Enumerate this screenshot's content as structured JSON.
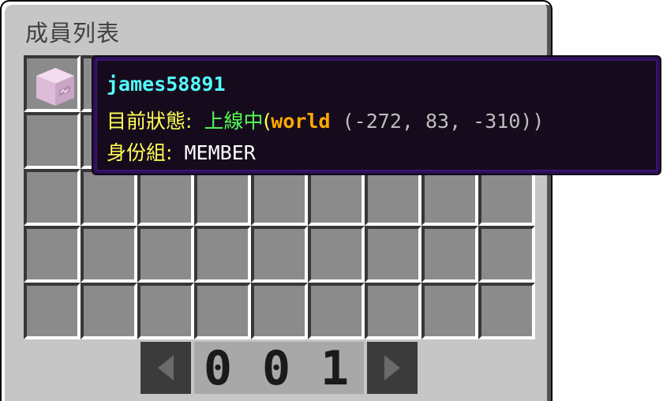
{
  "window": {
    "title": "成員列表"
  },
  "grid": {
    "rows": 5,
    "cols": 9,
    "filled_slot": "member-head-block"
  },
  "tooltip": {
    "player_name": "james58891",
    "status_label": "目前狀態:",
    "status_value": "上線中",
    "open_paren": "(",
    "world": "world",
    "coords": "(-272, 83, -310))",
    "role_label": "身份組:",
    "role_value": "MEMBER"
  },
  "pagination": {
    "digit1": "0",
    "digit2": "0",
    "digit3": "1",
    "prev_icon": "triangle-left-icon",
    "next_icon": "triangle-right-icon"
  },
  "colors": {
    "panel": "#c6c6c6",
    "slot": "#8b8b8b",
    "tooltip_bg": "#160b1c",
    "tooltip_border": "#2a0f55",
    "name": "#55ffff",
    "label": "#ffff55",
    "online": "#55ff55",
    "world": "#ffaa00"
  }
}
